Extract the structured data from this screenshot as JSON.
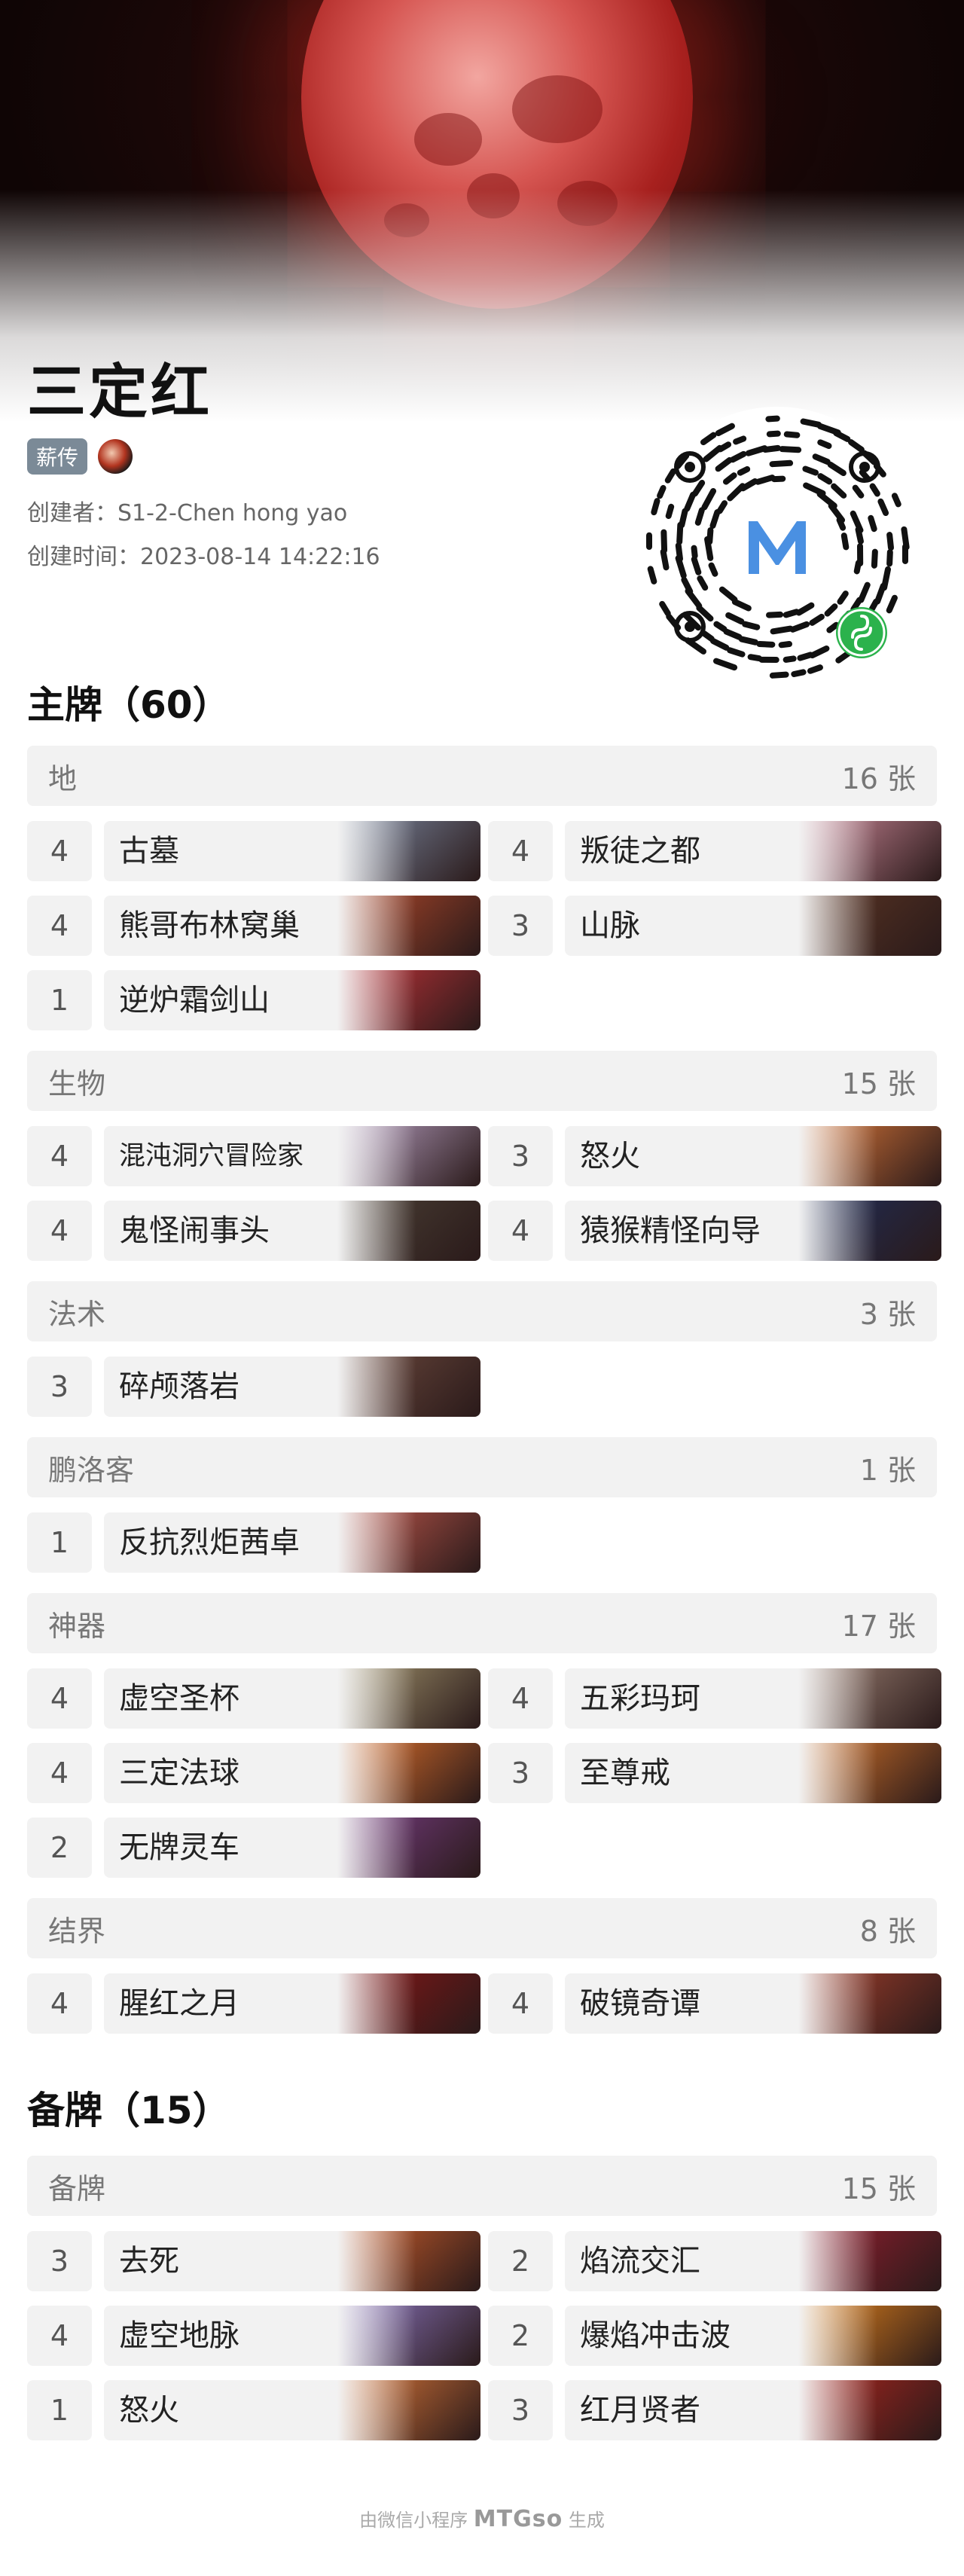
{
  "header": {
    "title": "三定红",
    "badge": "薪传",
    "creator": "创建者：S1-2-Chen hong yao",
    "created": "创建时间：2023-08-14 14:22:16"
  },
  "main": {
    "title": "主牌（60）",
    "groups": [
      {
        "name": "地",
        "count": "16 张",
        "cards": [
          {
            "qty": "4",
            "name": "古墓",
            "art": "#7d8aa3"
          },
          {
            "qty": "4",
            "name": "叛徒之都",
            "art": "#d08a9b"
          },
          {
            "qty": "4",
            "name": "熊哥布林窝巢",
            "art": "#b64a2b"
          },
          {
            "qty": "3",
            "name": "山脉",
            "art": "#5d3624"
          },
          {
            "qty": "1",
            "name": "逆炉霜剑山",
            "art": "#c7343a"
          }
        ]
      },
      {
        "name": "生物",
        "count": "15 张",
        "cards": [
          {
            "qty": "4",
            "name": "混沌洞穴冒险家",
            "art": "#bba3c6"
          },
          {
            "qty": "3",
            "name": "怒火",
            "art": "#e07a3a"
          },
          {
            "qty": "4",
            "name": "鬼怪闹事头",
            "art": "#4c4136"
          },
          {
            "qty": "4",
            "name": "猿猴精怪向导",
            "art": "#1f2e5a"
          }
        ]
      },
      {
        "name": "法术",
        "count": "3 张",
        "cards": [
          {
            "qty": "3",
            "name": "碎颅落岩",
            "art": "#6e4a3e"
          }
        ]
      },
      {
        "name": "鹏洛客",
        "count": "1 张",
        "cards": [
          {
            "qty": "1",
            "name": "反抗烈炬茜卓",
            "art": "#c45a4e"
          }
        ]
      },
      {
        "name": "神器",
        "count": "17 张",
        "cards": [
          {
            "qty": "4",
            "name": "虚空圣杯",
            "art": "#a69870"
          },
          {
            "qty": "4",
            "name": "五彩玛珂",
            "art": "#a08476"
          },
          {
            "qty": "4",
            "name": "三定法球",
            "art": "#e6742c"
          },
          {
            "qty": "3",
            "name": "至尊戒",
            "art": "#d9762a"
          },
          {
            "qty": "2",
            "name": "无牌灵车",
            "art": "#7a3e86"
          }
        ]
      },
      {
        "name": "结界",
        "count": "8 张",
        "cards": [
          {
            "qty": "4",
            "name": "腥红之月",
            "art": "#8c1616"
          },
          {
            "qty": "4",
            "name": "破镜奇谭",
            "art": "#a8402c"
          }
        ]
      }
    ]
  },
  "side": {
    "title": "备牌（15）",
    "groups": [
      {
        "name": "备牌",
        "count": "15 张",
        "cards": [
          {
            "qty": "3",
            "name": "去死",
            "art": "#d0602c"
          },
          {
            "qty": "2",
            "name": "焰流交汇",
            "art": "#9a1f30"
          },
          {
            "qty": "4",
            "name": "虚空地脉",
            "art": "#8e78c4"
          },
          {
            "qty": "2",
            "name": "爆焰冲击波",
            "art": "#e8861c"
          },
          {
            "qty": "1",
            "name": "怒火",
            "art": "#e07a3a"
          },
          {
            "qty": "3",
            "name": "红月贤者",
            "art": "#b2261e"
          }
        ]
      }
    ]
  },
  "footer": {
    "prefix": "由微信小程序",
    "brand": "MTGso",
    "suffix": "生成"
  },
  "colors": {
    "category_bg": "#f2f2f2",
    "badge_bg": "#7b8a97",
    "qr_accent": "#4a90e2",
    "qr_badge": "#2bb24c"
  }
}
